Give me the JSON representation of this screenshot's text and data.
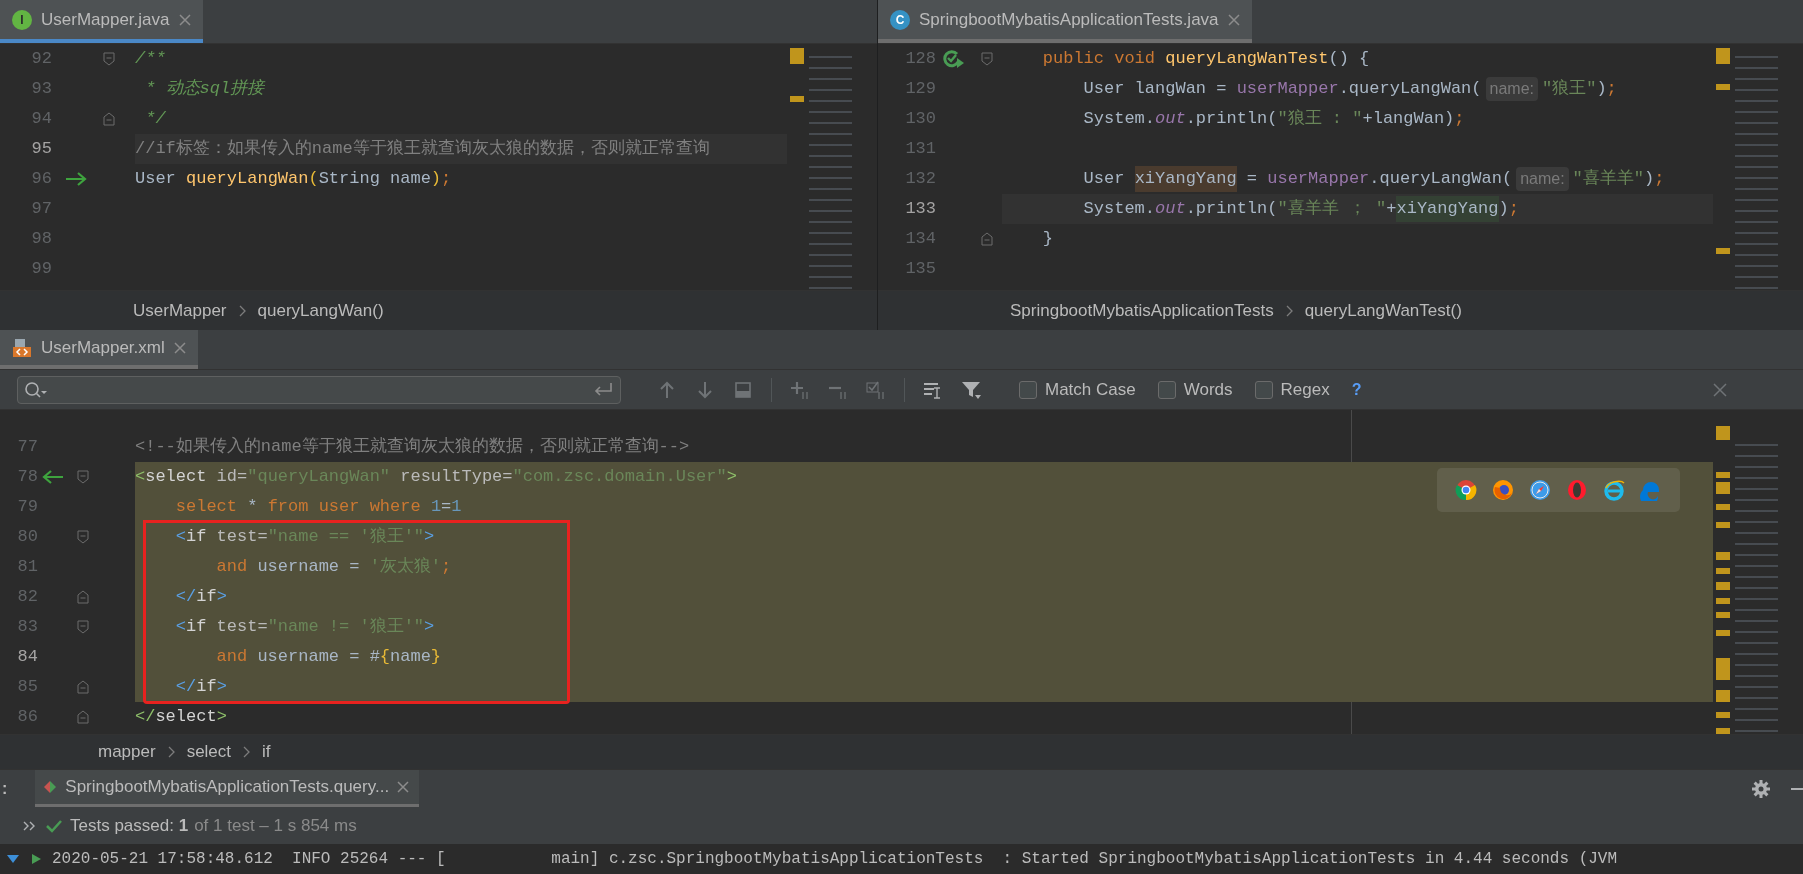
{
  "editors": [
    {
      "tab": {
        "label": "UserMapper.java",
        "icon_letter": "I",
        "selected": true,
        "focused": true
      },
      "lines": [
        {
          "number": "92",
          "fold_marker": {
            "kind": "open"
          },
          "current": false,
          "tokens": [
            {
              "text": "/**",
              "kind": "doc"
            }
          ]
        },
        {
          "number": "93",
          "current": false,
          "tokens": [
            {
              "text": " * 动态sql拼接",
              "kind": "doc"
            }
          ]
        },
        {
          "number": "94",
          "fold_marker": {
            "kind": "close"
          },
          "current": false,
          "tokens": [
            {
              "text": " */",
              "kind": "doc"
            }
          ]
        },
        {
          "number": "95",
          "current": true,
          "tokens": [
            {
              "text": "//if标签：如果传入的name等于狼王就查询灰太狼的数据，否则就正常查询",
              "kind": "comment"
            }
          ]
        },
        {
          "number": "96",
          "gutter_icon": {
            "kind": "arrow-right"
          },
          "current": false,
          "tokens": [
            {
              "text": "User ",
              "kind": "plain"
            },
            {
              "text": "queryLangWan",
              "kind": "fn"
            },
            {
              "text": "(",
              "kind": "paren"
            },
            {
              "text": "String name",
              "kind": "plain"
            },
            {
              "text": ")",
              "kind": "paren"
            },
            {
              "text": ";",
              "kind": "kw"
            }
          ]
        },
        {
          "number": "97",
          "current": false
        },
        {
          "number": "98",
          "current": false
        },
        {
          "number": "99",
          "current": false
        }
      ],
      "breadcrumbs": [
        "UserMapper",
        "queryLangWan()"
      ]
    },
    {
      "tab": {
        "label": "SpringbootMybatisApplicationTests.java",
        "icon_letter": "C",
        "selected": true,
        "focused": false
      },
      "lines": [
        {
          "number": "128",
          "gutter_icon": {
            "kind": "run"
          },
          "fold_marker": {
            "kind": "open"
          },
          "current": false,
          "tokens": [
            {
              "text": "    public void ",
              "kind": "kw"
            },
            {
              "text": "queryLangWanTest",
              "kind": "fn"
            },
            {
              "text": "() {",
              "kind": "plain"
            }
          ]
        },
        {
          "number": "129",
          "current": false,
          "tokens": [
            {
              "text": "        User langWan = ",
              "kind": "plain"
            },
            {
              "text": "userMapper",
              "kind": "field"
            },
            {
              "text": ".queryLangWan(",
              "kind": "plain"
            },
            {
              "text": "name:",
              "kind": "hint"
            },
            {
              "text": "\"狼王\"",
              "kind": "str"
            },
            {
              "text": ")",
              "kind": "plain"
            },
            {
              "text": ";",
              "kind": "kw"
            }
          ]
        },
        {
          "number": "130",
          "current": false,
          "tokens": [
            {
              "text": "        System.",
              "kind": "plain"
            },
            {
              "text": "out",
              "kind": "static"
            },
            {
              "text": ".println(",
              "kind": "plain"
            },
            {
              "text": "\"狼王 : \"",
              "kind": "str"
            },
            {
              "text": "+langWan)",
              "kind": "plain"
            },
            {
              "text": ";",
              "kind": "kw"
            }
          ]
        },
        {
          "number": "131",
          "current": false
        },
        {
          "number": "132",
          "current": false,
          "tokens": [
            {
              "text": "        User ",
              "kind": "plain"
            },
            {
              "text": "xiYangYang",
              "kind": "usage-write"
            },
            {
              "text": " = ",
              "kind": "plain"
            },
            {
              "text": "userMapper",
              "kind": "field"
            },
            {
              "text": ".queryLangWan(",
              "kind": "plain"
            },
            {
              "text": "name:",
              "kind": "hint"
            },
            {
              "text": "\"喜羊羊\"",
              "kind": "str"
            },
            {
              "text": ")",
              "kind": "plain"
            },
            {
              "text": ";",
              "kind": "kw"
            }
          ]
        },
        {
          "number": "133",
          "current": true,
          "tokens": [
            {
              "text": "        System.",
              "kind": "plain"
            },
            {
              "text": "out",
              "kind": "static"
            },
            {
              "text": ".println(",
              "kind": "plain"
            },
            {
              "text": "\"喜羊羊 ； \"",
              "kind": "str"
            },
            {
              "text": "+",
              "kind": "plain"
            },
            {
              "text": "xiYangYang",
              "kind": "usage-read"
            },
            {
              "text": ")",
              "kind": "plain"
            },
            {
              "text": ";",
              "kind": "kw"
            }
          ]
        },
        {
          "number": "134",
          "fold_marker": {
            "kind": "close"
          },
          "current": false,
          "tokens": [
            {
              "text": "    }",
              "kind": "plain"
            }
          ]
        },
        {
          "number": "135",
          "current": false
        }
      ],
      "breadcrumbs": [
        "SpringbootMybatisApplicationTests",
        "queryLangWanTest()"
      ]
    }
  ],
  "xml_editor": {
    "tab": {
      "label": "UserMapper.xml",
      "selected": true,
      "focused": false
    },
    "search": {
      "options": [
        {
          "label": "Match Case",
          "checked": false
        },
        {
          "label": "Words",
          "checked": false
        },
        {
          "label": "Regex",
          "checked": false
        }
      ],
      "help": "?"
    },
    "lines": [
      {
        "number": "77",
        "current": false,
        "selected": false,
        "boxed": false,
        "tokens": [
          {
            "text": "<!--如果传入的name等于狼王就查询灰太狼的数据，否则就正常查询-->",
            "kind": "comment"
          }
        ]
      },
      {
        "number": "78",
        "gutter_icon": {
          "kind": "arrow-left"
        },
        "fold_marker": {
          "kind": "open"
        },
        "current": false,
        "selected": true,
        "boxed": false,
        "tokens": [
          {
            "text": "<",
            "kind": "punct-green"
          },
          {
            "text": "select",
            "kind": "tag"
          },
          {
            "text": " id=",
            "kind": "attr"
          },
          {
            "text": "\"queryLangWan\"",
            "kind": "str"
          },
          {
            "text": " resultType=",
            "kind": "attr"
          },
          {
            "text": "\"com.zsc.domain.User\"",
            "kind": "str"
          },
          {
            "text": ">",
            "kind": "punct-green"
          }
        ]
      },
      {
        "number": "79",
        "current": false,
        "selected": true,
        "boxed": false,
        "tokens": [
          {
            "text": "    select",
            "kind": "kw"
          },
          {
            "text": " * ",
            "kind": "plain"
          },
          {
            "text": "from user where ",
            "kind": "kw"
          },
          {
            "text": "1",
            "kind": "num"
          },
          {
            "text": "=",
            "kind": "plain"
          },
          {
            "text": "1",
            "kind": "num"
          }
        ]
      },
      {
        "number": "80",
        "fold_marker": {
          "kind": "open"
        },
        "current": false,
        "selected": true,
        "boxed": true,
        "tokens": [
          {
            "text": "    <",
            "kind": "punct-blue"
          },
          {
            "text": "if",
            "kind": "tag"
          },
          {
            "text": " test=",
            "kind": "attr"
          },
          {
            "text": "\"name == '狼王'\"",
            "kind": "str"
          },
          {
            "text": ">",
            "kind": "punct-blue"
          }
        ]
      },
      {
        "number": "81",
        "current": false,
        "selected": true,
        "boxed": true,
        "tokens": [
          {
            "text": "        and",
            "kind": "kw"
          },
          {
            "text": " username = ",
            "kind": "plain"
          },
          {
            "text": "'灰太狼'",
            "kind": "str"
          },
          {
            "text": ";",
            "kind": "kw"
          }
        ]
      },
      {
        "number": "82",
        "fold_marker": {
          "kind": "close"
        },
        "current": false,
        "selected": true,
        "boxed": true,
        "tokens": [
          {
            "text": "    </",
            "kind": "punct-blue"
          },
          {
            "text": "if",
            "kind": "tag"
          },
          {
            "text": ">",
            "kind": "punct-blue"
          }
        ]
      },
      {
        "number": "83",
        "fold_marker": {
          "kind": "open"
        },
        "current": false,
        "selected": true,
        "boxed": true,
        "tokens": [
          {
            "text": "    <",
            "kind": "punct-blue"
          },
          {
            "text": "if",
            "kind": "tag"
          },
          {
            "text": " test=",
            "kind": "attr"
          },
          {
            "text": "\"name != '狼王'\"",
            "kind": "str"
          },
          {
            "text": ">",
            "kind": "punct-blue"
          }
        ]
      },
      {
        "number": "84",
        "current": true,
        "selected": true,
        "boxed": true,
        "tokens": [
          {
            "text": "        and",
            "kind": "kw"
          },
          {
            "text": " username = #",
            "kind": "plain"
          },
          {
            "text": "{",
            "kind": "paren"
          },
          {
            "text": "name",
            "kind": "plain"
          },
          {
            "text": "}",
            "kind": "paren"
          }
        ]
      },
      {
        "number": "85",
        "fold_marker": {
          "kind": "close"
        },
        "current": false,
        "selected": true,
        "boxed": true,
        "tokens": [
          {
            "text": "    </",
            "kind": "punct-blue"
          },
          {
            "text": "if",
            "kind": "tag"
          },
          {
            "text": ">",
            "kind": "punct-blue"
          }
        ]
      },
      {
        "number": "86",
        "fold_marker": {
          "kind": "close"
        },
        "current": false,
        "selected": false,
        "boxed": false,
        "tokens": [
          {
            "text": "</",
            "kind": "punct-green"
          },
          {
            "text": "select",
            "kind": "tag"
          },
          {
            "text": ">",
            "kind": "punct-green"
          }
        ]
      }
    ],
    "breadcrumbs": [
      "mapper",
      "select",
      "if"
    ]
  },
  "run_panel": {
    "menu": ":",
    "tab": {
      "label": "SpringbootMybatisApplicationTests.query...",
      "selected": true
    },
    "status": "Tests passed: **1**",
    "detail": "of 1 test – 1 s 854 ms",
    "log": [
      "2020-05-21 17:58:48.612  INFO 25264 --- [           main] c.zsc.SpringbootMybatisApplicationTests  : Started SpringbootMybatisApplicationTests in 4.44 seconds (JVM"
    ]
  }
}
